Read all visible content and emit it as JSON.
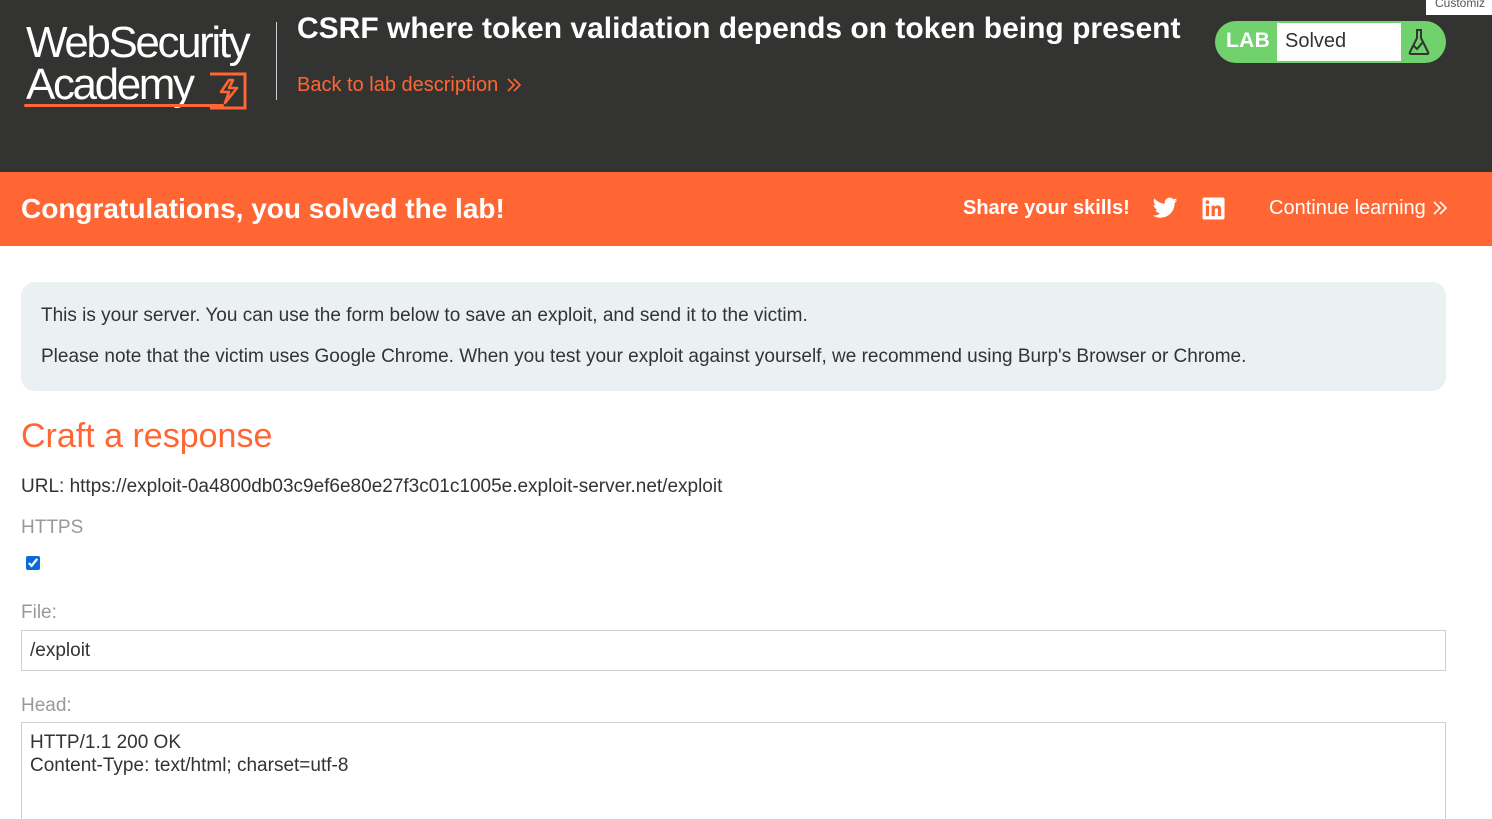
{
  "header": {
    "logo_line1": "WebSecurity",
    "logo_line2": "Academy",
    "lab_title": "CSRF where token validation depends on token being present",
    "back_link": "Back to lab description",
    "lab_badge": "LAB",
    "lab_status": "Solved",
    "customize_tab": "Customiz"
  },
  "banner": {
    "message": "Congratulations, you solved the lab!",
    "share": "Share your skills!",
    "continue": "Continue learning",
    "icons": [
      "twitter-icon",
      "linkedin-icon"
    ]
  },
  "info": {
    "line1": "This is your server. You can use the form below to save an exploit, and send it to the victim.",
    "line2": "Please note that the victim uses Google Chrome. When you test your exploit against yourself, we recommend using Burp's Browser or Chrome."
  },
  "form": {
    "heading": "Craft a response",
    "url_line": "URL: https://exploit-0a4800db03c9ef6e80e27f3c01c1005e.exploit-server.net/exploit",
    "https_label": "HTTPS",
    "https_checked": true,
    "file_label": "File:",
    "file_value": "/exploit",
    "head_label": "Head:",
    "head_value": "HTTP/1.1 200 OK\nContent-Type: text/html; charset=utf-8"
  },
  "colors": {
    "dark": "#333332",
    "accent": "#ff6633",
    "solved": "#70d16d",
    "info_bg": "#ebf0f2"
  }
}
